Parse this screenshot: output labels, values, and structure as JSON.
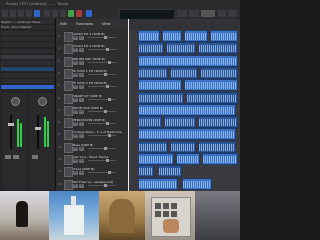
{
  "window": {
    "title": "Project TEST  [Untitled] - ... - Tracks"
  },
  "toolbar": {
    "edit_menu": "Edit",
    "functions_menu": "Functions",
    "view_menu": "View"
  },
  "inspector": {
    "header": "Region: ... audio per Move",
    "track_label": "Track: 'Drum Master'"
  },
  "tracks": [
    {
      "num": "1",
      "name": "AUDIO KIT 1 (SIDE B)"
    },
    {
      "num": "2",
      "name": "AUDIO KIT 2 (SIDE B)"
    },
    {
      "num": "3",
      "name": "DRUMS MPC (SIDE B)"
    },
    {
      "num": "4",
      "name": "HI HATS 1 KIT (SIDE B)"
    },
    {
      "num": "5",
      "name": "HI HATS 2 KIT (SIDE B)"
    },
    {
      "num": "6",
      "name": "SNARE KIT (SIDE B)"
    },
    {
      "num": "7",
      "name": "BOOM MAP (SIDE B)"
    },
    {
      "num": "8",
      "name": "PERCUSSION (SIDE B)"
    },
    {
      "num": "9",
      "name": "Vintage Piano - T...s of Baltimore"
    },
    {
      "num": "10",
      "name": "Bass (SIDE B)"
    },
    {
      "num": "11",
      "name": "Jazz Line - Mood Theme"
    },
    {
      "num": "12",
      "name": "Vibes (SIDE B)"
    },
    {
      "num": "13",
      "name": "Tell Them (a...samples list)"
    }
  ],
  "colors": {
    "region": "#3a73c4",
    "accent_blue": "#2f64c8",
    "meter_green": "#2bd14b"
  }
}
